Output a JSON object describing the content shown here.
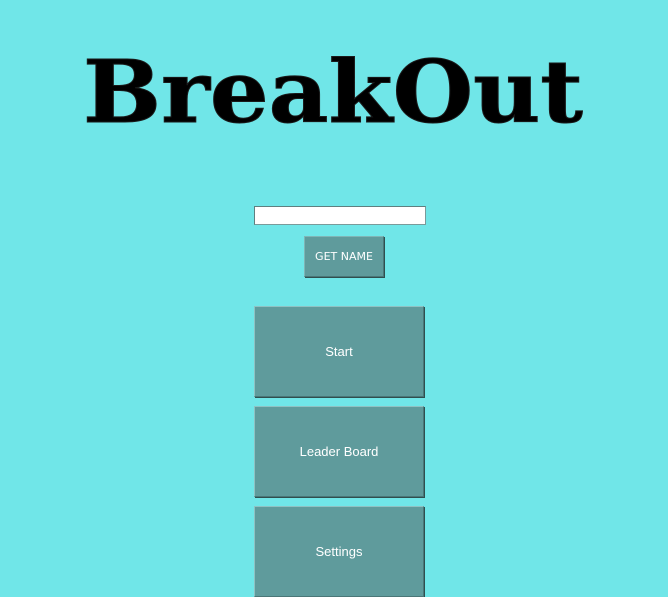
{
  "title": {
    "text": "BreakOut"
  },
  "name_entry": {
    "value": "",
    "placeholder": ""
  },
  "get_name_button": {
    "label": "GET NAME"
  },
  "menu": {
    "start_label": "Start",
    "leaderboard_label": "Leader Board",
    "settings_label": "Settings"
  },
  "colors": {
    "background": "#70e6e8",
    "button": "#5f9b9c",
    "button_text": "#ffffff",
    "title": "#000000"
  }
}
